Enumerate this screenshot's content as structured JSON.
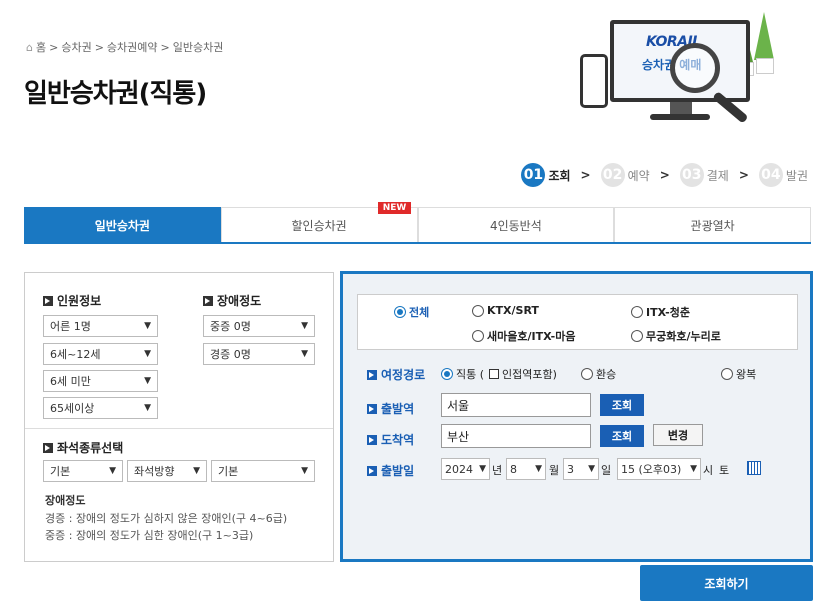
{
  "breadcrumb": {
    "home": "홈",
    "sep": ">",
    "items": [
      "승차권",
      "승차권예약",
      "일반승차권"
    ]
  },
  "page_title": "일반승차권(직통)",
  "hero": {
    "logo": "KORAIL",
    "text": "승차권 예매"
  },
  "steps": [
    {
      "num": "01",
      "label": "조회"
    },
    {
      "num": "02",
      "label": "예약"
    },
    {
      "num": "03",
      "label": "결제"
    },
    {
      "num": "04",
      "label": "발권"
    }
  ],
  "step_sep": ">",
  "tabs": [
    "일반승차권",
    "할인승차권",
    "4인동반석",
    "관광열차"
  ],
  "new_badge": "NEW",
  "left": {
    "passenger_title": "인원정보",
    "disability_title": "장애정도",
    "adult": "어른 1명",
    "child": "6세~12세",
    "toddler": "6세 미만",
    "senior": "65세이상",
    "severe": "중증 0명",
    "mild": "경증 0명",
    "seat_title": "좌석종류선택",
    "seat_type": "기본",
    "seat_dir": "좌석방향",
    "seat_default": "기본",
    "note_title": "장애정도",
    "note1": "경증 : 장애의 정도가 심하지 않은 장애인(구 4~6급)",
    "note2": "중증 : 장애의 정도가 심한 장애인(구 1~3급)"
  },
  "right": {
    "train_all": "전체",
    "train_ktx": "KTX/SRT",
    "train_itx_cheongchun": "ITX-청춘",
    "train_saemaeul": "새마을호/ITX-마음",
    "train_mugunghwa": "무궁화호/누리로",
    "route_label": "여정경로",
    "route_direct": "직통 (",
    "route_adjacent": "인접역포함)",
    "route_transfer": "환승",
    "route_round": "왕복",
    "depart_label": "출발역",
    "depart_value": "서울",
    "arrive_label": "도착역",
    "arrive_value": "부산",
    "lookup": "조회",
    "change": "변경",
    "date_label": "출발일",
    "year": "2024",
    "year_unit": "년",
    "month": "8",
    "month_unit": "월",
    "day": "3",
    "day_unit": "일",
    "hour": "15 (오후03)",
    "hour_unit": "시",
    "weekday": "토"
  },
  "search_button": "조회하기",
  "colors": {
    "accent": "#1a78c2",
    "dark_blue": "#1a5fb4",
    "badge": "#e02a2a"
  }
}
